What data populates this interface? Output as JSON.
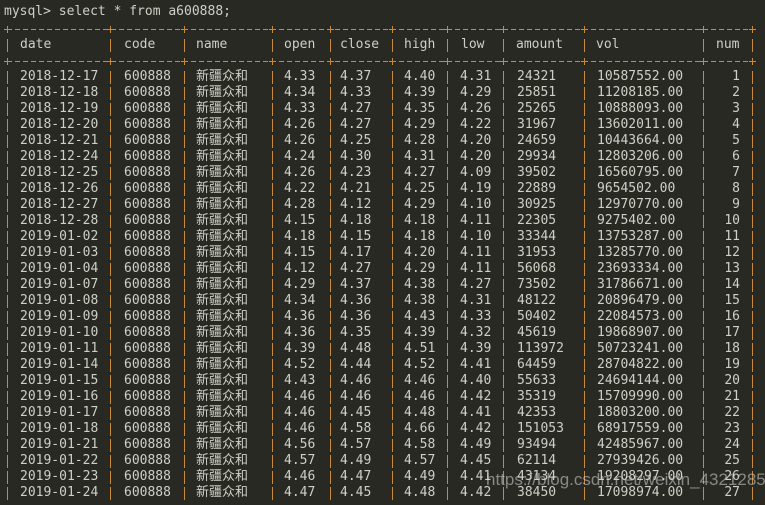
{
  "terminal": {
    "prompt": "mysql> select * from a600888;"
  },
  "table": {
    "columns": [
      "date",
      "code",
      "name",
      "open",
      "close",
      "high",
      "low",
      "amount",
      "vol",
      "num"
    ],
    "rows": [
      [
        "2018-12-17",
        "600888",
        "新疆众和",
        "4.33",
        "4.37",
        "4.40",
        "4.31",
        "24321",
        "10587552.00",
        "1"
      ],
      [
        "2018-12-18",
        "600888",
        "新疆众和",
        "4.34",
        "4.33",
        "4.39",
        "4.29",
        "25851",
        "11208185.00",
        "2"
      ],
      [
        "2018-12-19",
        "600888",
        "新疆众和",
        "4.33",
        "4.27",
        "4.35",
        "4.26",
        "25265",
        "10888093.00",
        "3"
      ],
      [
        "2018-12-20",
        "600888",
        "新疆众和",
        "4.26",
        "4.27",
        "4.29",
        "4.22",
        "31967",
        "13602011.00",
        "4"
      ],
      [
        "2018-12-21",
        "600888",
        "新疆众和",
        "4.26",
        "4.25",
        "4.28",
        "4.20",
        "24659",
        "10443664.00",
        "5"
      ],
      [
        "2018-12-24",
        "600888",
        "新疆众和",
        "4.24",
        "4.30",
        "4.31",
        "4.20",
        "29934",
        "12803206.00",
        "6"
      ],
      [
        "2018-12-25",
        "600888",
        "新疆众和",
        "4.26",
        "4.23",
        "4.27",
        "4.09",
        "39502",
        "16560795.00",
        "7"
      ],
      [
        "2018-12-26",
        "600888",
        "新疆众和",
        "4.22",
        "4.21",
        "4.25",
        "4.19",
        "22889",
        "9654502.00",
        "8"
      ],
      [
        "2018-12-27",
        "600888",
        "新疆众和",
        "4.28",
        "4.12",
        "4.29",
        "4.10",
        "30925",
        "12970770.00",
        "9"
      ],
      [
        "2018-12-28",
        "600888",
        "新疆众和",
        "4.15",
        "4.18",
        "4.18",
        "4.11",
        "22305",
        "9275402.00",
        "10"
      ],
      [
        "2019-01-02",
        "600888",
        "新疆众和",
        "4.18",
        "4.15",
        "4.18",
        "4.10",
        "33344",
        "13753287.00",
        "11"
      ],
      [
        "2019-01-03",
        "600888",
        "新疆众和",
        "4.15",
        "4.17",
        "4.20",
        "4.11",
        "31953",
        "13285770.00",
        "12"
      ],
      [
        "2019-01-04",
        "600888",
        "新疆众和",
        "4.12",
        "4.27",
        "4.29",
        "4.11",
        "56068",
        "23693334.00",
        "13"
      ],
      [
        "2019-01-07",
        "600888",
        "新疆众和",
        "4.29",
        "4.37",
        "4.38",
        "4.27",
        "73502",
        "31786671.00",
        "14"
      ],
      [
        "2019-01-08",
        "600888",
        "新疆众和",
        "4.34",
        "4.36",
        "4.38",
        "4.31",
        "48122",
        "20896479.00",
        "15"
      ],
      [
        "2019-01-09",
        "600888",
        "新疆众和",
        "4.36",
        "4.36",
        "4.43",
        "4.33",
        "50402",
        "22084573.00",
        "16"
      ],
      [
        "2019-01-10",
        "600888",
        "新疆众和",
        "4.36",
        "4.35",
        "4.39",
        "4.32",
        "45619",
        "19868907.00",
        "17"
      ],
      [
        "2019-01-11",
        "600888",
        "新疆众和",
        "4.39",
        "4.48",
        "4.51",
        "4.39",
        "113972",
        "50723241.00",
        "18"
      ],
      [
        "2019-01-14",
        "600888",
        "新疆众和",
        "4.52",
        "4.44",
        "4.52",
        "4.41",
        "64459",
        "28704822.00",
        "19"
      ],
      [
        "2019-01-15",
        "600888",
        "新疆众和",
        "4.43",
        "4.46",
        "4.46",
        "4.40",
        "55633",
        "24694144.00",
        "20"
      ],
      [
        "2019-01-16",
        "600888",
        "新疆众和",
        "4.46",
        "4.46",
        "4.46",
        "4.42",
        "35319",
        "15709990.00",
        "21"
      ],
      [
        "2019-01-17",
        "600888",
        "新疆众和",
        "4.46",
        "4.45",
        "4.48",
        "4.41",
        "42353",
        "18803200.00",
        "22"
      ],
      [
        "2019-01-18",
        "600888",
        "新疆众和",
        "4.46",
        "4.58",
        "4.66",
        "4.42",
        "151053",
        "68917559.00",
        "23"
      ],
      [
        "2019-01-21",
        "600888",
        "新疆众和",
        "4.56",
        "4.57",
        "4.58",
        "4.49",
        "93494",
        "42485967.00",
        "24"
      ],
      [
        "2019-01-22",
        "600888",
        "新疆众和",
        "4.57",
        "4.49",
        "4.57",
        "4.45",
        "62114",
        "27939426.00",
        "25"
      ],
      [
        "2019-01-23",
        "600888",
        "新疆众和",
        "4.46",
        "4.47",
        "4.49",
        "4.41",
        "43134",
        "19208297.00",
        "26"
      ],
      [
        "2019-01-24",
        "600888",
        "新疆众和",
        "4.47",
        "4.45",
        "4.48",
        "4.42",
        "38450",
        "17098974.00",
        "27"
      ]
    ]
  },
  "watermark": "https://blog.csdn.net/weixin_43212852",
  "colors": {
    "background": "#282923",
    "text": "#cfcfc6",
    "border": "#c98a3c"
  }
}
